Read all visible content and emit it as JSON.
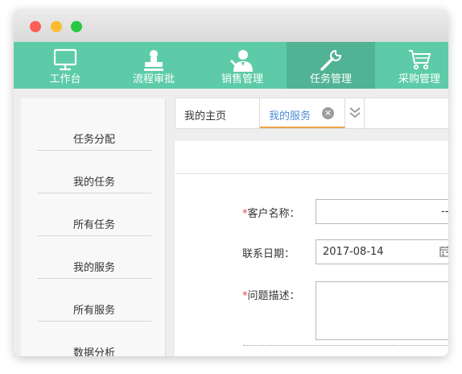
{
  "nav": {
    "items": [
      {
        "label": "工作台",
        "icon": "monitor-icon"
      },
      {
        "label": "流程审批",
        "icon": "stamp-icon"
      },
      {
        "label": "销售管理",
        "icon": "user-tie-icon"
      },
      {
        "label": "任务管理",
        "icon": "wrench-icon",
        "active": true
      },
      {
        "label": "采购管理",
        "icon": "cart-icon"
      }
    ]
  },
  "sidebar": {
    "items": [
      {
        "label": "任务分配"
      },
      {
        "label": "我的任务"
      },
      {
        "label": "所有任务"
      },
      {
        "label": "我的服务"
      },
      {
        "label": "所有服务"
      },
      {
        "label": "数据分析"
      }
    ]
  },
  "tabs": {
    "home_label": "我的主页",
    "active_label": "我的服务",
    "close_glyph": "✕"
  },
  "form": {
    "required_mark": "*",
    "customer_label": "客户名称：",
    "customer_value": "--",
    "date_label": "联系日期：",
    "date_value": "2017-08-14",
    "desc_label": "问题描述："
  },
  "colors": {
    "accent": "#5dcba8",
    "accent_active": "#50b394",
    "tab_active_text": "#4d8fd6",
    "tab_active_underline": "#f0a24a",
    "required": "#e64545"
  }
}
